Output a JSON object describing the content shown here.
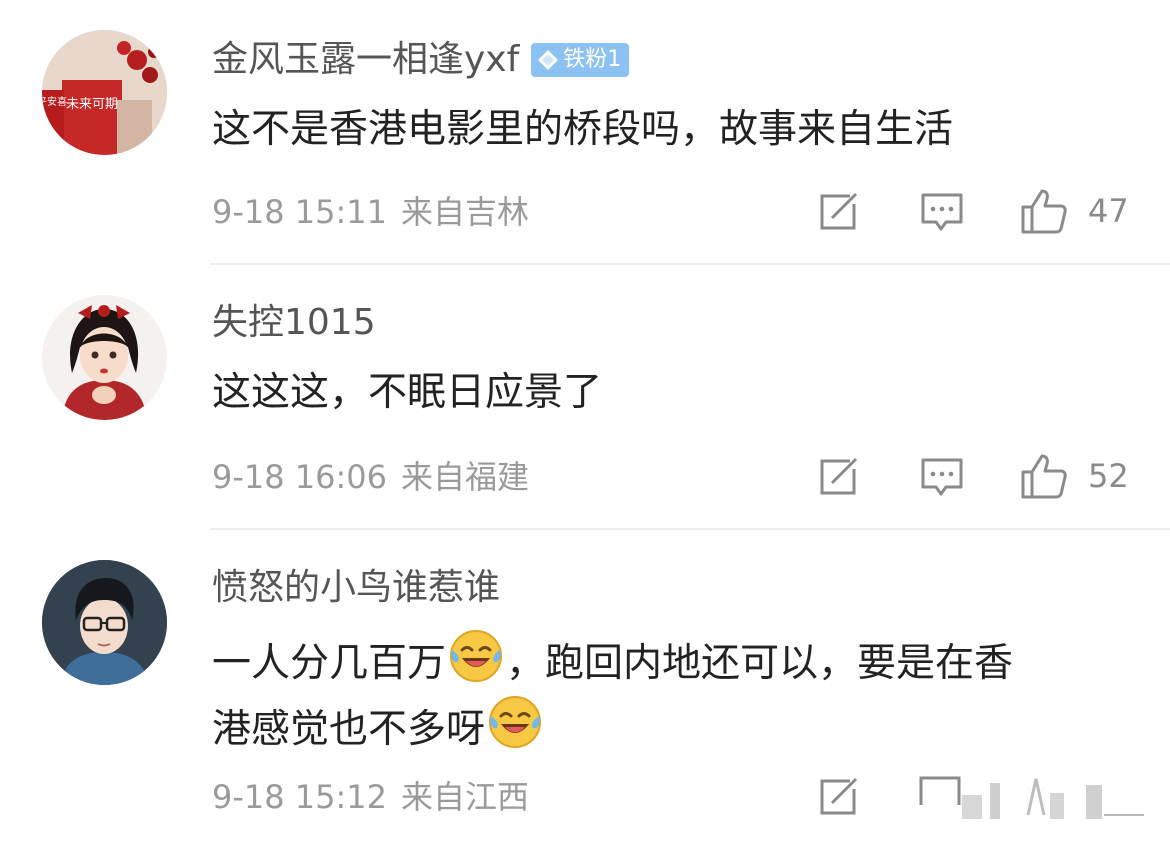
{
  "comments": [
    {
      "username": "金风玉露一相逢yxf",
      "badge": "铁粉1",
      "text": "这不是香港电影里的桥段吗，故事来自生活",
      "time": "9-18 15:11",
      "location": "来自吉林",
      "likes": "47",
      "avatar_book_text": "未来可期",
      "avatar_book_side": "平安喜"
    },
    {
      "username": "失控1015",
      "text": "这这这，不眠日应景了",
      "time": "9-18 16:06",
      "location": "来自福建",
      "likes": "52"
    },
    {
      "username": "愤怒的小鸟谁惹谁",
      "text_line1_a": "一人分几百万",
      "text_line1_b": "，跑回内地还可以，要是在香",
      "text_line2": "港感觉也不多呀",
      "time": "9-18 15:12",
      "location": "来自江西"
    }
  ],
  "icons": {
    "repost": "repost-icon",
    "comment": "comment-icon",
    "like": "thumbs-up-icon",
    "emoji": "laugh-cry-emoji",
    "badge_gem": "diamond-icon"
  },
  "colors": {
    "badge_bg": "#8cc2f3",
    "icon_gray": "#8a8a8a",
    "meta_gray": "#9a9a9a"
  }
}
